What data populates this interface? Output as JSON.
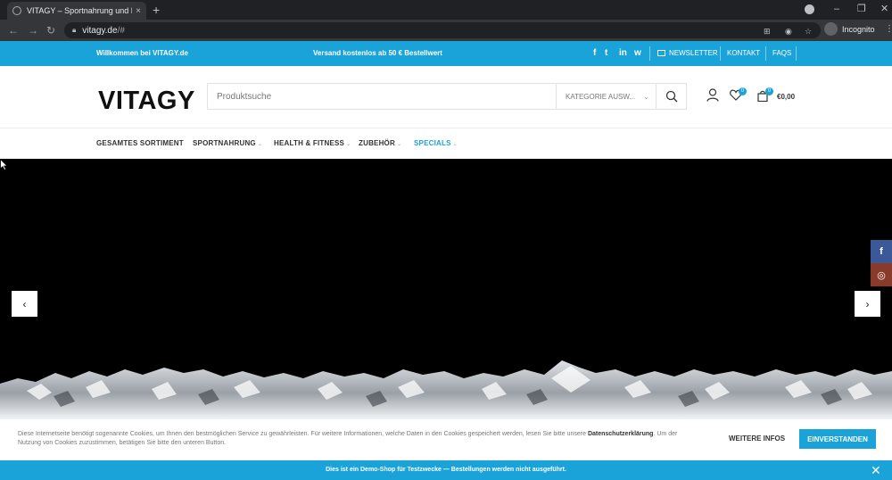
{
  "browser": {
    "tab_title": "VITAGY – Sportnahrung und Fitne",
    "tab_close": "×",
    "new_tab": "+",
    "url": "vitagy.de",
    "url_suffix": "/#",
    "profile_label": "Incognito",
    "minimize": "–",
    "maximize": "❐",
    "close": "✕"
  },
  "topbar": {
    "welcome": "Willkommen bei VITAGY.de",
    "shipping": "Versand kostenlos ab 50 € Bestellwert",
    "social": [
      "f",
      "t",
      "in",
      "w"
    ],
    "newsletter": "NEWSLETTER",
    "contact": "KONTAKT",
    "faqs": "FAQS"
  },
  "header": {
    "logo": "VITAGY",
    "search_placeholder": "Produktsuche",
    "category_select": "KATEGORIE AUSW...",
    "wishlist_count": "0",
    "cart_count": "0",
    "cart_total": "€0,00"
  },
  "menu": {
    "items": [
      {
        "label": "GESAMTES SORTIMENT"
      },
      {
        "label": "SPORTNAHRUNG"
      },
      {
        "label": "HEALTH & FITNESS"
      },
      {
        "label": "ZUBEHÖR"
      },
      {
        "label": "SPECIALS"
      }
    ]
  },
  "slider": {
    "prev": "‹",
    "next": "›"
  },
  "side_social": {
    "facebook": "f",
    "instagram": "◎",
    "colors": {
      "facebook": "#3b5998",
      "instagram": "#8a3a2a"
    }
  },
  "cookie": {
    "text_1": "Diese Internetseite benötigt sogenannte Cookies, um Ihnen den bestmöglichen Service zu gewährleisten. Für weitere Informationen, welche Daten in den Cookies gespeichert werden, lesen Sie bitte unsere ",
    "link": "Datenschutzerklärung",
    "text_2": ". Um der Nutzung von Cookies zuzustimmen, betätigen Sie bitte den unteren Button.",
    "more_info": "WEITERE INFOS",
    "accept": "EINVERSTANDEN"
  },
  "demo_bar": {
    "text": "Dies ist ein Demo-Shop für Testzwecke — Bestellungen werden nicht ausgeführt.",
    "close": "✕"
  },
  "colors": {
    "accent": "#1aa3d9",
    "chrome_dark": "#202124",
    "chrome_toolbar": "#35363a"
  }
}
